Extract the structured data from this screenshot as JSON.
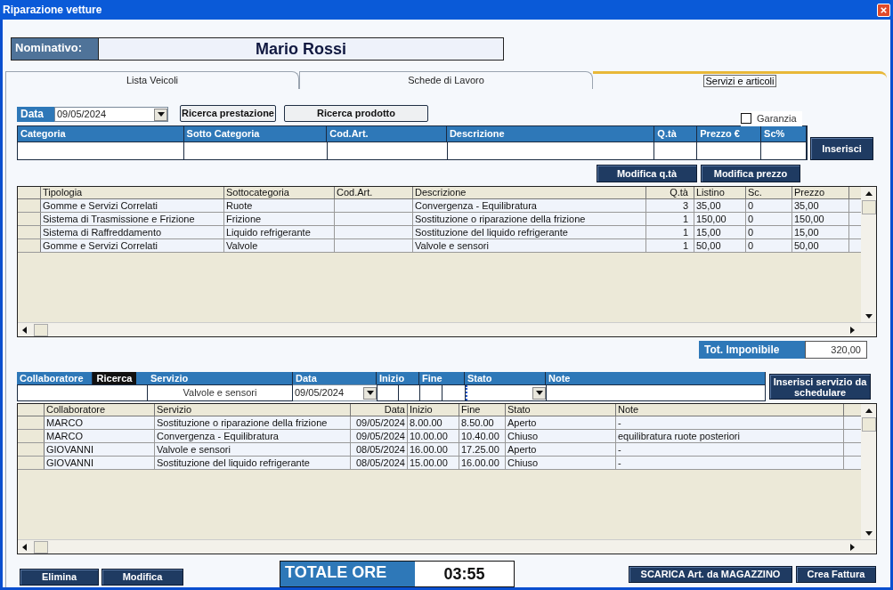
{
  "window": {
    "title": "Riparazione vetture"
  },
  "nominativo": {
    "label": "Nominativo:",
    "value": "Mario Rossi"
  },
  "tabs": [
    {
      "label": "Lista Veicoli",
      "selected": false
    },
    {
      "label": "Schede di Lavoro",
      "selected": false
    },
    {
      "label": "Servizi e articoli",
      "selected": true
    }
  ],
  "search": {
    "date_label": "Data",
    "date_value": "09/05/2024",
    "buttons": [
      "Ricerca prestazione",
      "Ricerca prodotto"
    ],
    "warranty": {
      "label": "Garanzia",
      "checked": false
    }
  },
  "entry_columns": [
    "Categoria",
    "Sotto Categoria",
    "Cod.Art.",
    "Descrizione",
    "Q.tà",
    "Prezzo €",
    "Sc%"
  ],
  "insert_button": "Inserisci",
  "edit_buttons": [
    "Modifica q.tà",
    "Modifica prezzo"
  ],
  "items_table": {
    "columns": [
      "Tipologia",
      "Sottocategoria",
      "Cod.Art.",
      "Descrizione",
      "Q.tà",
      "Listino",
      "Sc.",
      "Prezzo"
    ],
    "rows": [
      [
        "Gomme e Servizi Correlati",
        "Ruote",
        "",
        "Convergenza - Equilibratura",
        "3",
        "35,00",
        "0",
        "35,00"
      ],
      [
        "Sistema di Trasmissione e Frizione",
        "Frizione",
        "",
        "Sostituzione o riparazione della frizione",
        "1",
        "150,00",
        "0",
        "150,00"
      ],
      [
        "Sistema di Raffreddamento",
        "Liquido refrigerante",
        "",
        "Sostituzione del liquido refrigerante",
        "1",
        "15,00",
        "0",
        "15,00"
      ],
      [
        "Gomme e Servizi Correlati",
        "Valvole",
        "",
        "Valvole e sensori",
        "1",
        "50,00",
        "0",
        "50,00"
      ]
    ]
  },
  "total_taxable": {
    "label": "Tot. Imponibile",
    "value": "320,00"
  },
  "schedule_filter": {
    "collaborator_label": "Collaboratore",
    "search_button": "Ricerca",
    "service_label": "Servizio",
    "service_value": "Valvole e sensori",
    "date_label": "Data",
    "date_value": "09/05/2024",
    "start_label": "Inizio",
    "end_label": "Fine",
    "status_label": "Stato",
    "notes_label": "Note"
  },
  "schedule_button": "Inserisci servizio da schedulare",
  "schedule_table": {
    "columns": [
      "Collaboratore",
      "Servizio",
      "Data",
      "Inizio",
      "Fine",
      "Stato",
      "Note"
    ],
    "rows": [
      [
        "MARCO",
        "Sostituzione o riparazione della frizione",
        "09/05/2024",
        "8.00.00",
        "8.50.00",
        "Aperto",
        "-"
      ],
      [
        "MARCO",
        "Convergenza - Equilibratura",
        "09/05/2024",
        "10.00.00",
        "10.40.00",
        "Chiuso",
        "equilibratura ruote posteriori"
      ],
      [
        "GIOVANNI",
        "Valvole e sensori",
        "08/05/2024",
        "16.00.00",
        "17.25.00",
        "Aperto",
        "-"
      ],
      [
        "GIOVANNI",
        "Sostituzione del liquido refrigerante",
        "08/05/2024",
        "15.00.00",
        "16.00.00",
        "Chiuso",
        "-"
      ]
    ]
  },
  "bottom_buttons_left": [
    "Elimina",
    "Modifica"
  ],
  "total_hours": {
    "label": "TOTALE ORE",
    "value": "03:55"
  },
  "bottom_buttons_right": [
    "SCARICA Art. da MAGAZZINO",
    "Crea Fattura"
  ]
}
